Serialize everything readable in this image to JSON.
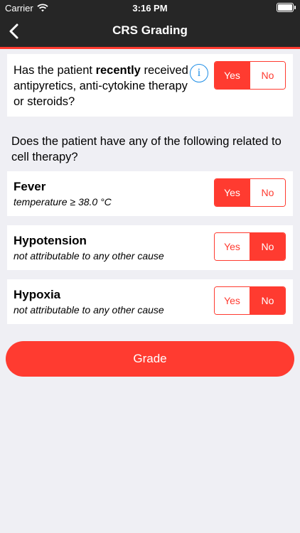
{
  "status_bar": {
    "carrier": "Carrier",
    "time": "3:16 PM"
  },
  "nav": {
    "title": "CRS Grading",
    "back_icon": "chevron-left-icon"
  },
  "accent_color": "#ff3b30",
  "question": {
    "text_before": "Has the patient ",
    "text_bold": "recently",
    "text_after": " received antipyretics, anti-cytokine therapy or steroids?",
    "info_icon": "info-icon",
    "info_glyph": "i",
    "yes_label": "Yes",
    "no_label": "No",
    "selected": "Yes"
  },
  "section_label": "Does the patient have any of the following related to cell therapy?",
  "items": [
    {
      "name": "Fever",
      "description": "temperature ≥ 38.0 °C",
      "yes_label": "Yes",
      "no_label": "No",
      "selected": "Yes"
    },
    {
      "name": "Hypotension",
      "description": "not attributable to any other cause",
      "yes_label": "Yes",
      "no_label": "No",
      "selected": "No"
    },
    {
      "name": "Hypoxia",
      "description": "not attributable to any other cause",
      "yes_label": "Yes",
      "no_label": "No",
      "selected": "No"
    }
  ],
  "grade_button": "Grade"
}
